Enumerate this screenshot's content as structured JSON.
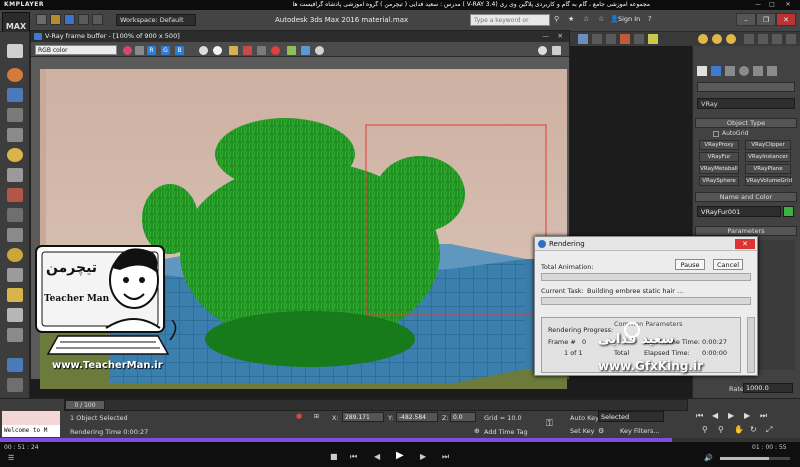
{
  "player": {
    "brand": "KMPLAYER",
    "title": "مجموعه آموزشی جامع ، گام به گام و کاربردی پلاگین وی ری (V-RAY 3.4 )  مدرس : سعید فدایی ( تیچرمن ) گروه آموزشی پادشاه گرافیست ها",
    "time_elapsed": "00 : 51 : 24",
    "time_total": "01 : 00 : 55"
  },
  "max": {
    "logo": "MAX",
    "workspace": "Workspace: Default",
    "title": "Autodesk 3ds Max 2016    material.max",
    "search_placeholder": "Type a keyword or phrase",
    "sign_in": "Sign In"
  },
  "vfb": {
    "title": "V-Ray frame buffer - [100% of 900 x 500]",
    "channel": "RGB color",
    "buttons": [
      "R",
      "G",
      "B"
    ]
  },
  "rendering": {
    "title": "Rendering",
    "total_animation_label": "Total Animation:",
    "pause": "Pause",
    "cancel": "Cancel",
    "current_task_label": "Current Task:",
    "current_task": "Building embree static hair ...",
    "rendering_progress": "Rendering Progress:",
    "common_parameters": "Common Parameters",
    "frame_label": "Frame #",
    "frame_value": "0",
    "of_value": "1 of 1",
    "total_label": "Total",
    "last_frame_time_label": "Last Frame Time:",
    "last_frame_time": "0:00:27",
    "elapsed_time_label": "Elapsed Time:",
    "elapsed_time": "0:00:00"
  },
  "command_panel": {
    "category": "VRay",
    "object_type": "Object Type",
    "autogrid": "AutoGrid",
    "vray_buttons": [
      "VRayProxy",
      "VRayClipper",
      "VRayFur",
      "VRayInstancer",
      "VRayMetaball",
      "VRayPlane",
      "VRaySphere",
      "VRayVolumeGrid"
    ],
    "name_and_color": "Name and Color",
    "object_name": "VRayFur001",
    "parameters": "Parameters",
    "rate_label": "Rate",
    "rate_value": "1000.0",
    "accent": "#3cb043"
  },
  "status": {
    "frame_counter": "0 / 100",
    "selection": "1 Object Selected",
    "rendering_time": "Rendering Time  0:00:27",
    "welcome": "Welcome to M",
    "x_label": "X:",
    "x_value": "289.171",
    "y_label": "Y:",
    "y_value": "-482.584",
    "z_label": "Z:",
    "z_value": "0.0",
    "grid": "Grid = 10.0",
    "add_time_tag": "Add Time Tag",
    "auto_key": "Auto Key",
    "selected": "Selected",
    "set_key": "Set Key",
    "key_filters": "Key Filters..."
  },
  "watermarks": {
    "teacherman_url": "www.TeacherMan.ir",
    "gfxking_url": "www.GfxKing.ir",
    "teacher_name_fa": "تیچرمن",
    "teacher_name_en": "Teacher Man",
    "teacher_fullname_fa": "سعید فدایی"
  }
}
